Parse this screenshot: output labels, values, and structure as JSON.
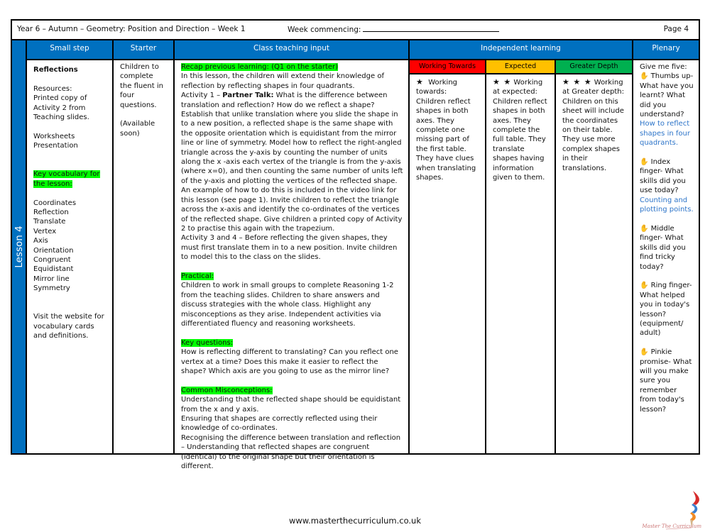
{
  "header": {
    "title": "Year 6 – Autumn – Geometry: Position and Direction  – Week 1",
    "week_commencing_label": "Week commencing:",
    "page": "Page 4"
  },
  "lesson_label": "Lesson 4",
  "columns": {
    "small_step": "Small step",
    "starter": "Starter",
    "class_teaching": "Class teaching input",
    "independent": "Independent learning",
    "plenary": "Plenary"
  },
  "small_step": {
    "title": "Reflections",
    "resources_label": "Resources:",
    "resources": [
      "Printed copy of",
      "Activity 2 from",
      "Teaching slides."
    ],
    "materials": [
      "Worksheets",
      "Presentation"
    ],
    "vocab_heading_1": "Key vocabulary for",
    "vocab_heading_2": "the lesson:",
    "vocabulary": [
      "Coordinates",
      "Reflection",
      "Translate",
      "Vertex",
      "Axis",
      "Orientation",
      "Congruent",
      "Equidistant",
      "Mirror line",
      "Symmetry"
    ],
    "website_note": "Visit the website for vocabulary cards and definitions."
  },
  "starter": {
    "text": "Children to complete the fluent in four questions.",
    "note": "(Available soon)"
  },
  "teaching": {
    "recap_heading": "Recap previous learning: (Q1 on the starter)",
    "intro": "In this lesson, the children will extend their knowledge of reflection by reflecting shapes in four quadrants.",
    "activity1_prefix": "Activity 1 – ",
    "activity1_bold": "Partner Talk:",
    "activity1_text": " What is the difference between translation and reflection? How do we reflect a shape? Establish that unlike translation where you slide the shape in to a new position, a reflected shape is the same shape with  the opposite orientation which is equidistant from the mirror line or line of symmetry.  Model how to reflect the right-angled triangle across the y-axis by counting the number of units along the x -axis each vertex of the triangle is from the y-axis (where x=0), and then counting the same number of units  left of the y-axis and plotting the vertices  of the reflected shape. An example of how to do this is included in the video link for this lesson (see page 1). Invite children to reflect the triangle across the x-axis and identify the co-ordinates of the vertices of the reflected shape.  Give children a printed copy of  Activity 2 to practise this again with the trapezium.",
    "activity34": "Activity 3 and 4 – Before reflecting the given shapes, they must first translate them in to a new position. Invite children to model this to the class on the slides.",
    "practical_heading": "Practical:",
    "practical": "Children to work in small groups to complete Reasoning 1-2 from the teaching slides. Children to share answers and discuss strategies with the whole class. Highlight any misconceptions as they arise. Independent activities via differentiated fluency and reasoning worksheets.",
    "key_questions_heading": "Key questions:",
    "key_questions": "How is reflecting different to translating? Can you reflect one vertex at a time? Does this make it easier to reflect the shape? Which axis are you going to use as the mirror line?",
    "misconceptions_heading": "Common Misconceptions:",
    "misconceptions": [
      "Understanding that the reflected shape should be equidistant from the x and y axis.",
      "Ensuring that shapes are correctly reflected using their knowledge of co-ordinates.",
      "Recognising the difference between translation and reflection – Understanding that reflected shapes are congruent (identical) to the original shape but their orientation is different."
    ]
  },
  "independent": {
    "groups": [
      {
        "label": "Working Towards",
        "color": "#ff0000",
        "stars": "★",
        "text_lead": "Working towards:",
        "text": "Children reflect shapes in both axes. They complete one missing part of the first table. They have clues when translating shapes."
      },
      {
        "label": "Expected",
        "color": "#ffc000",
        "stars": "★ ★",
        "text_lead": "Working at expected:",
        "text": "Children reflect shapes in both axes. They complete the full table. They translate shapes having information given to them."
      },
      {
        "label": "Greater Depth",
        "color": "#00b050",
        "stars": "★ ★ ★",
        "text_lead": "Working at Greater depth:",
        "text": "Children on this sheet will include the coordinates on their table. They use more complex shapes in their translations."
      }
    ]
  },
  "plenary": {
    "intro": "Give me five:",
    "items": [
      {
        "icon": "hand-icon",
        "text": "Thumbs up- What have you learnt? What did you understand?",
        "answer": "How to reflect shapes in four quadrants."
      },
      {
        "icon": "hand-icon",
        "text": "Index finger- What skills did you use today?",
        "answer": "Counting and plotting points."
      },
      {
        "icon": "hand-icon",
        "text": "Middle finger- What skills did you find tricky today?",
        "answer": ""
      },
      {
        "icon": "hand-icon",
        "text": "Ring finger- What helped you in today's lesson? (equipment/ adult)",
        "answer": ""
      },
      {
        "icon": "hand-icon",
        "text": "Pinkie promise- What will you make sure you remember from today's lesson?",
        "answer": ""
      }
    ]
  },
  "footer": {
    "url": "www.masterthecurriculum.co.uk",
    "logo_text": "Master The Curriculum"
  },
  "colors": {
    "header_blue": "#0070c0",
    "highlight": "#00ff00",
    "working_towards": "#ff0000",
    "expected": "#ffc000",
    "greater_depth": "#00b050",
    "answer_blue": "#2e75c9"
  }
}
